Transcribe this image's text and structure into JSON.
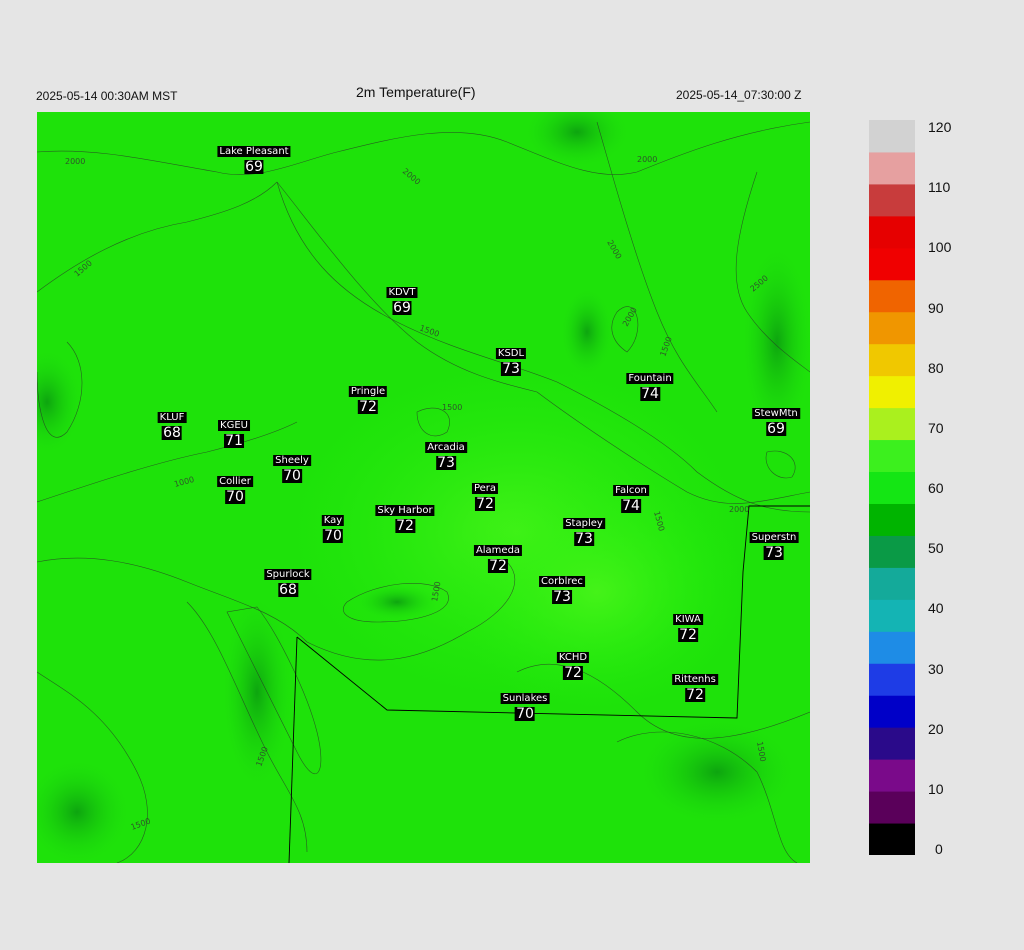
{
  "header": {
    "title": "2m Temperature(F)",
    "local_time": "2025-05-14 00:30AM MST",
    "utc_time": "2025-05-14_07:30:00 Z"
  },
  "stations": [
    {
      "name": "Lake Pleasant",
      "value": "69"
    },
    {
      "name": "KDVT",
      "value": "69"
    },
    {
      "name": "KSDL",
      "value": "73"
    },
    {
      "name": "Pringle",
      "value": "72"
    },
    {
      "name": "Fountain",
      "value": "74"
    },
    {
      "name": "KLUF",
      "value": "68"
    },
    {
      "name": "KGEU",
      "value": "71"
    },
    {
      "name": "Arcadia",
      "value": "73"
    },
    {
      "name": "StewMtn",
      "value": "69"
    },
    {
      "name": "Sheely",
      "value": "70"
    },
    {
      "name": "Collier",
      "value": "70"
    },
    {
      "name": "Pera",
      "value": "72"
    },
    {
      "name": "Falcon",
      "value": "74"
    },
    {
      "name": "Kay",
      "value": "70"
    },
    {
      "name": "Sky Harbor",
      "value": "72"
    },
    {
      "name": "Stapley",
      "value": "73"
    },
    {
      "name": "Superstn",
      "value": "73"
    },
    {
      "name": "Alameda",
      "value": "72"
    },
    {
      "name": "Spurlock",
      "value": "68"
    },
    {
      "name": "Corblrec",
      "value": "73"
    },
    {
      "name": "KIWA",
      "value": "72"
    },
    {
      "name": "KCHD",
      "value": "72"
    },
    {
      "name": "Rittenhs",
      "value": "72"
    },
    {
      "name": "Sunlakes",
      "value": "70"
    }
  ],
  "contour_labels": [
    "2000",
    "1500",
    "1000",
    "2500"
  ],
  "colorbar": {
    "ticks": [
      "0",
      "10",
      "20",
      "30",
      "40",
      "50",
      "60",
      "70",
      "80",
      "90",
      "100",
      "110",
      "120"
    ],
    "colors": [
      "#000000",
      "#5a005a",
      "#7a0a8a",
      "#2a0a8a",
      "#0000c8",
      "#1e3ce6",
      "#1e8ce6",
      "#14b4b4",
      "#14aa9a",
      "#0a9a46",
      "#00b400",
      "#14e614",
      "#3cf01e",
      "#aaf01e",
      "#f0f000",
      "#f0c800",
      "#f09600",
      "#f06400",
      "#f00000",
      "#e60000",
      "#c83c3c",
      "#e6a0a0",
      "#d2d2d2"
    ]
  }
}
